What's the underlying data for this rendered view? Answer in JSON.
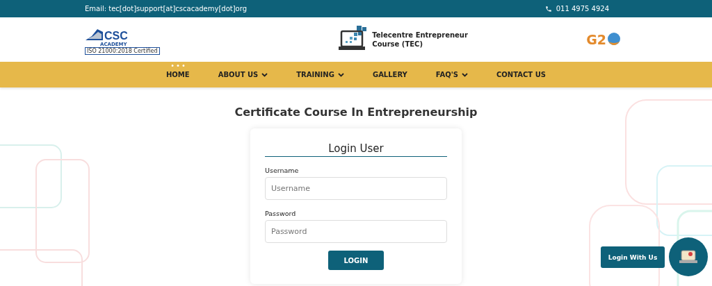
{
  "top_bar": {
    "email": "Email: tec[dot]support[at]cscacademy[dot]org",
    "phone": "011 4975 4924"
  },
  "header": {
    "csc_logo": {
      "letters": "CSC",
      "subtitle": "ACADEMY",
      "certification": "ISO 21000:2018 Certified"
    },
    "tec_logo": {
      "title": "Telecentre Entrepreneur Course (TEC)"
    },
    "g20_logo": {
      "letters": "G2"
    }
  },
  "nav": [
    {
      "label": "HOME",
      "selected": true,
      "dropdown": false
    },
    {
      "label": "ABOUT US",
      "selected": false,
      "dropdown": true
    },
    {
      "label": "TRAINING",
      "selected": false,
      "dropdown": true
    },
    {
      "label": "GALLERY",
      "selected": false,
      "dropdown": false
    },
    {
      "label": "FAQ'S",
      "selected": false,
      "dropdown": true
    },
    {
      "label": "CONTACT US",
      "selected": false,
      "dropdown": false
    }
  ],
  "page_title": "Certificate Course In Entrepreneurship",
  "login_card": {
    "title": "Login User",
    "fields": [
      {
        "label": "Username",
        "placeholder": "Username"
      },
      {
        "label": "Password",
        "placeholder": "Password"
      }
    ],
    "button": "LOGIN"
  },
  "floating_button": "Login With Us"
}
